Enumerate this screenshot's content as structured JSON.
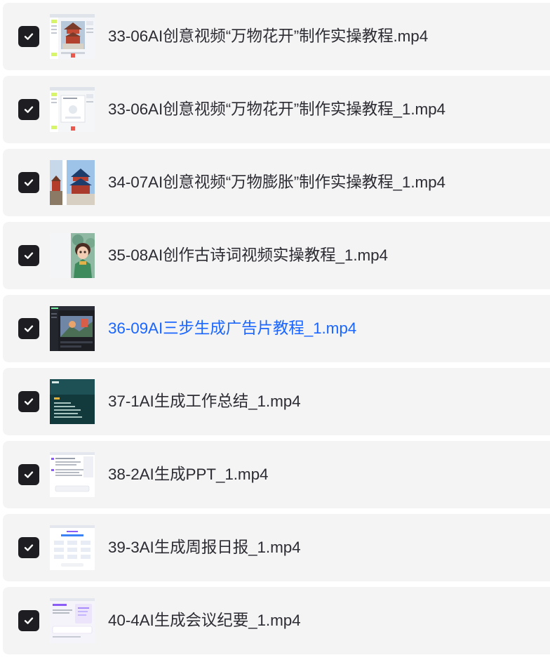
{
  "colors": {
    "row_background": "#f4f4f5",
    "checkbox": "#1d1d22",
    "text": "#2c2c33",
    "highlight": "#1a66ff"
  },
  "files": [
    {
      "name": "33-06AI创意视频“万物花开”制作实操教程.mp4",
      "checked": true,
      "highlighted": false,
      "thumbnail": "screenshot-temple-editor"
    },
    {
      "name": "33-06AI创意视频“万物花开”制作实操教程_1.mp4",
      "checked": true,
      "highlighted": false,
      "thumbnail": "screenshot-editor-dialog"
    },
    {
      "name": "34-07AI创意视频“万物膨胀”制作实操教程_1.mp4",
      "checked": true,
      "highlighted": false,
      "thumbnail": "temple-photo"
    },
    {
      "name": "35-08AI创作古诗词视频实操教程_1.mp4",
      "checked": true,
      "highlighted": false,
      "thumbnail": "cartoon-character"
    },
    {
      "name": "36-09AI三步生成广告片教程_1.mp4",
      "checked": true,
      "highlighted": true,
      "thumbnail": "dark-video-editor"
    },
    {
      "name": "37-1AI生成工作总结_1.mp4",
      "checked": true,
      "highlighted": false,
      "thumbnail": "dark-teal-slide"
    },
    {
      "name": "38-2AI生成PPT_1.mp4",
      "checked": true,
      "highlighted": false,
      "thumbnail": "chat-document"
    },
    {
      "name": "39-3AI生成周报日报_1.mp4",
      "checked": true,
      "highlighted": false,
      "thumbnail": "app-grid-page"
    },
    {
      "name": "40-4AI生成会议纪要_1.mp4",
      "checked": true,
      "highlighted": false,
      "thumbnail": "chat-panel-page"
    }
  ]
}
